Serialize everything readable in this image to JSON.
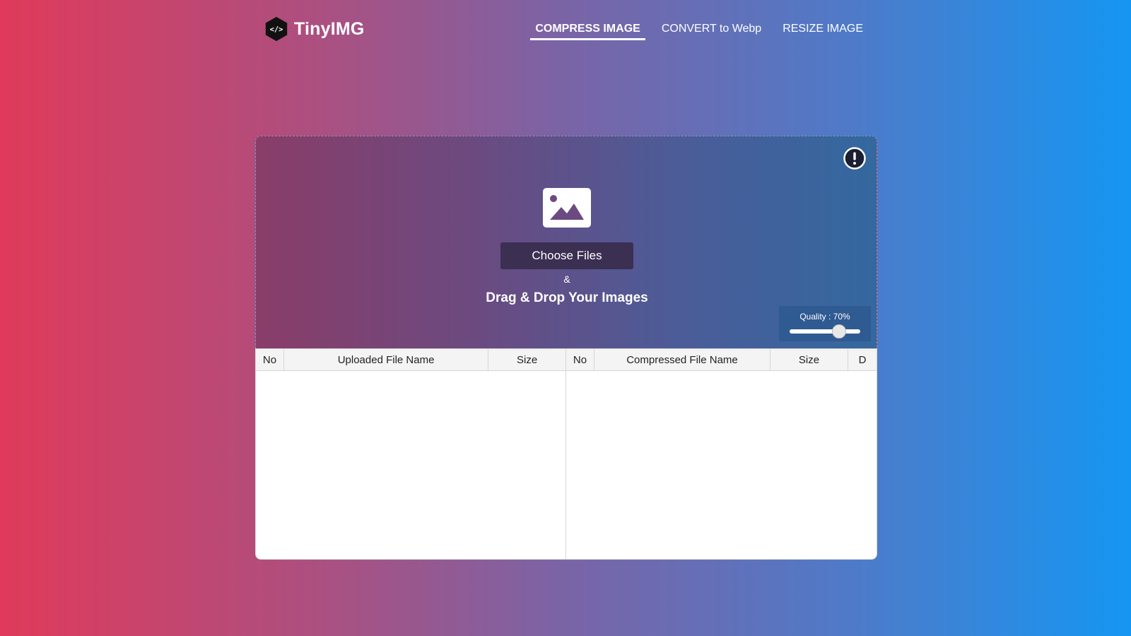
{
  "brand": {
    "name": "TinyIMG",
    "logo_icon": "hexagon-code-icon"
  },
  "nav": {
    "items": [
      {
        "label": "COMPRESS IMAGE",
        "active": true
      },
      {
        "label": "CONVERT to Webp",
        "active": false
      },
      {
        "label": "RESIZE IMAGE",
        "active": false
      }
    ]
  },
  "upload": {
    "choose_label": "Choose Files",
    "ampersand": "&",
    "drag_text": "Drag & Drop Your Images",
    "image_icon": "image-icon",
    "info_icon": "exclamation-circle-icon"
  },
  "quality": {
    "label": "Quality : 70%",
    "value": 70,
    "min": 0,
    "max": 100
  },
  "uploaded_table": {
    "headers": [
      "No",
      "Uploaded File Name",
      "Size"
    ],
    "rows": []
  },
  "compressed_table": {
    "headers": [
      "No",
      "Compressed File Name",
      "Size",
      "D"
    ],
    "rows": []
  },
  "colors": {
    "button_bg": "#3b2f52",
    "quality_box_bg": "#2f5a92",
    "gradient_left": "#e03a5a",
    "gradient_right": "#1596f2"
  }
}
